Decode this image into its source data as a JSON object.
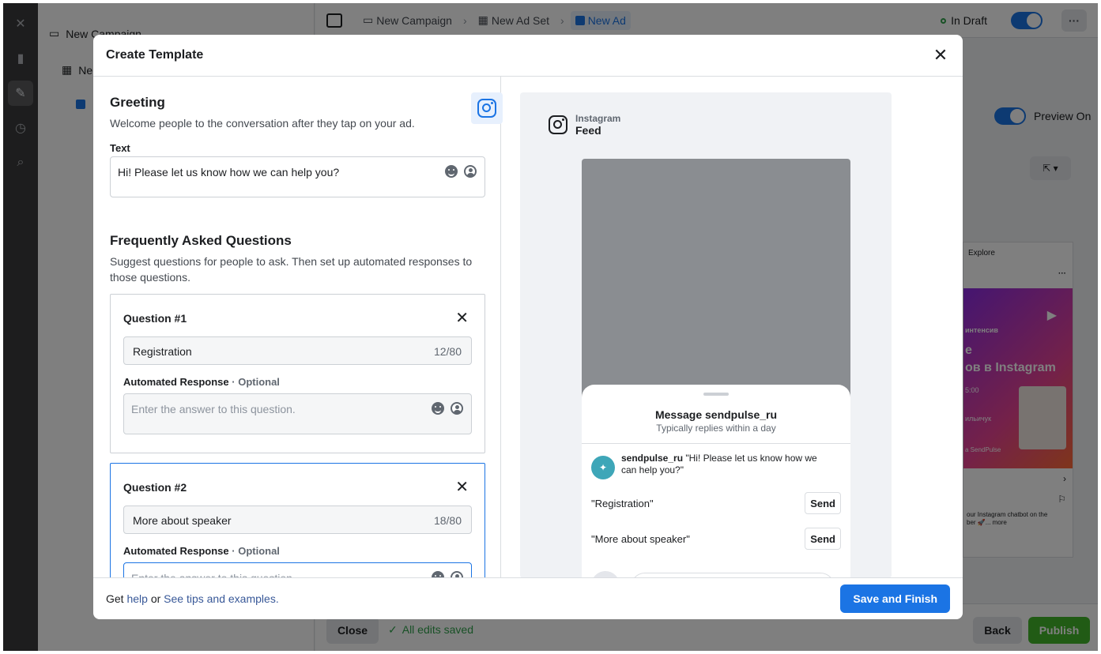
{
  "background": {
    "tree": {
      "campaign": "New Campaign",
      "adset_truncated": "Ne"
    },
    "breadcrumbs": [
      {
        "label": "New Campaign"
      },
      {
        "label": "New Ad Set"
      },
      {
        "label": "New Ad"
      }
    ],
    "status": "In Draft",
    "preview_toggle_label": "Preview On",
    "bottom": {
      "close_label": "Close",
      "saved_label": "All edits saved",
      "back_label": "Back",
      "publish_label": "Publish"
    },
    "right_pane": {
      "explore_label": "Explore",
      "ad_text_1": "интенсив",
      "ad_text_2": "е",
      "ad_text_3": "ов в Instagram",
      "ad_text_4": "5:00",
      "ad_text_5": "ильичук",
      "ad_text_6": "а SendPulse",
      "caption": "our Instagram chatbot on the",
      "caption2": "ber 🚀... more"
    }
  },
  "modal": {
    "title": "Create Template",
    "greeting": {
      "title": "Greeting",
      "description": "Welcome people to the conversation after they tap on your ad.",
      "text_label": "Text",
      "text_value": "Hi! Please let us know how we can help you?"
    },
    "faq": {
      "title": "Frequently Asked Questions",
      "description": "Suggest questions for people to ask. Then set up automated responses to those questions.",
      "questions": [
        {
          "title": "Question #1",
          "value": "Registration",
          "counter": "12/80",
          "response_label": "Automated Response",
          "optional_label": "· Optional",
          "response_placeholder": "Enter the answer to this question."
        },
        {
          "title": "Question #2",
          "value": "More about speaker",
          "counter": "18/80",
          "response_label": "Automated Response",
          "optional_label": "· Optional",
          "response_placeholder": "Enter the answer to this question."
        }
      ]
    },
    "preview": {
      "platform": "Instagram",
      "placement": "Feed",
      "sheet_title": "Message sendpulse_ru",
      "sheet_subtitle": "Typically replies within a day",
      "sender": "sendpulse_ru",
      "message": "\"Hi! Please let us know how we can help you?\"",
      "quick_replies": [
        {
          "text": "\"Registration\"",
          "send": "Send"
        },
        {
          "text": "\"More about speaker\"",
          "send": "Send"
        }
      ]
    },
    "footer": {
      "get": "Get",
      "help": "help",
      "or": "or",
      "tips": "See tips and examples.",
      "save_label": "Save and Finish"
    }
  },
  "colors": {
    "primary": "#1b74e4",
    "publish": "#42b72a",
    "draft_dot": "#31a24c"
  }
}
